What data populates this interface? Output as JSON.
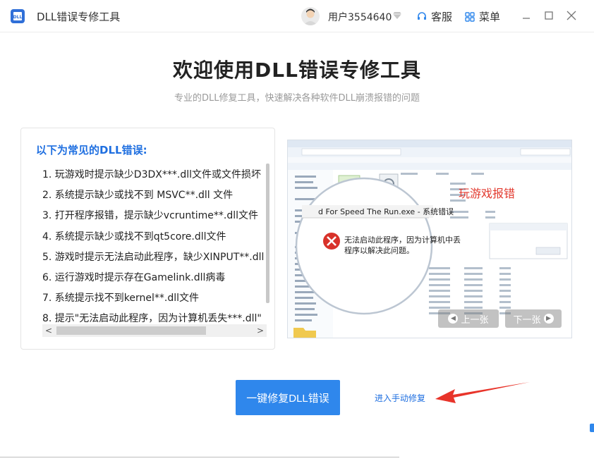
{
  "titlebar": {
    "app_title": "DLL错误专修工具",
    "username": "用户3554640",
    "service_label": "客服",
    "menu_label": "菜单",
    "icons": {
      "app_logo": "app-logo-icon",
      "vip": "diamond-icon",
      "service": "headset-icon",
      "menu": "grid-icon",
      "minimize": "minimize-icon",
      "maximize": "maximize-icon",
      "close": "close-icon"
    }
  },
  "hero": {
    "title": "欢迎使用DLL错误专修工具",
    "subtitle": "专业的DLL修复工具，快速解决各种软件DLL崩溃报错的问题"
  },
  "errors_card": {
    "title": "以下为常见的DLL错误:",
    "items": [
      "1. 玩游戏时提示缺少D3DX***.dll文件或文件损坏",
      "2. 系统提示缺少或找不到 MSVC**.dll 文件",
      "3. 打开程序报错，提示缺少vcruntime**.dll文件",
      "4. 系统提示缺少或找不到qt5core.dll文件",
      "5. 游戏时提示无法启动此程序，缺少XINPUT**.dll",
      "6. 运行游戏时提示存在Gamelink.dll病毒",
      "7. 系统提示找不到kernel**.dll文件",
      "8. 提示\"无法启动此程序，因为计算机丢失***.dll\""
    ],
    "scroll_left": "<",
    "scroll_right": ">"
  },
  "carousel": {
    "label": "玩游戏报错",
    "magnifier_title": "d For Speed The Run.exe - 系统错误",
    "error_message_line1": "无法启动此程序，因为计算机中丢",
    "error_message_line2": "程序以解决此问题。",
    "prev_label": "上一张",
    "next_label": "下一张",
    "accent_color": "#e23a2f"
  },
  "actions": {
    "primary_label": "一键修复DLL错误",
    "manual_label": "进入手动修复",
    "primary_color": "#2f87ec",
    "arrow_color": "#e8342a"
  }
}
